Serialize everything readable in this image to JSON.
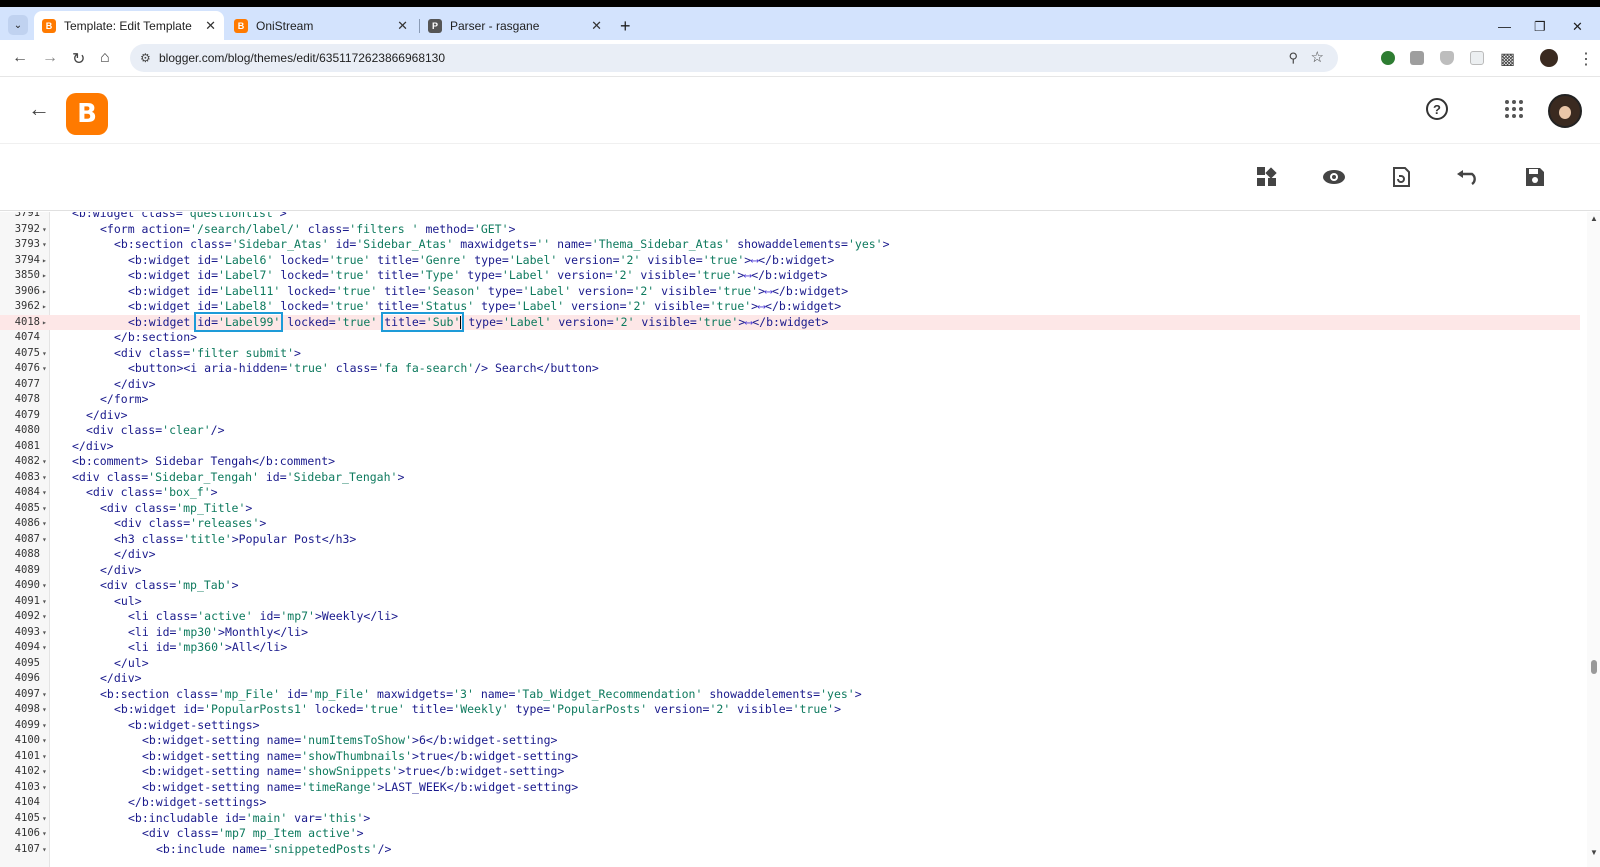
{
  "browser": {
    "tabs": [
      {
        "title": "Template: Edit Template",
        "favicon": "blogger-icon",
        "color": "#ff7a00",
        "active": true
      },
      {
        "title": "OniStream",
        "favicon": "blogger-icon",
        "color": "#ff7a00",
        "active": false
      },
      {
        "title": "Parser - rasgane",
        "favicon": "parser-icon",
        "color": "#555555",
        "active": false
      }
    ],
    "url": "blogger.com/blog/themes/edit/6351172623866968130",
    "new_tab_glyph": "+",
    "menu_glyph": "⌄",
    "close_glyph": "✕"
  },
  "app": {
    "logo_letter": "B",
    "help_glyph": "?",
    "toolbar": [
      "layout-icon",
      "preview-icon",
      "restore-icon",
      "undo-icon",
      "save-icon"
    ]
  },
  "editor": {
    "lines": [
      {
        "n": "3791",
        "f": "",
        "code": "<b:widget class='questionlist'>"
      },
      {
        "n": "3792",
        "f": "▾",
        "code": "<form action='/search/label/' class='filters ' method='GET'>"
      },
      {
        "n": "3793",
        "f": "▾",
        "code": "<b:section class='Sidebar_Atas' id='Sidebar_Atas' maxwidgets='' name='Thema_Sidebar_Atas' showaddelements='yes'>"
      },
      {
        "n": "3794",
        "f": "▸",
        "code": "<b:widget id='Label6' locked='true' title='Genre' type='Label' version='2' visible='true'>⟷</b:widget>"
      },
      {
        "n": "3850",
        "f": "▸",
        "code": "<b:widget id='Label7' locked='true' title='Type' type='Label' version='2' visible='true'>⟷</b:widget>"
      },
      {
        "n": "3906",
        "f": "▸",
        "code": "<b:widget id='Label11' locked='true' title='Season' type='Label' version='2' visible='true'>⟷</b:widget>"
      },
      {
        "n": "3962",
        "f": "▸",
        "code": "<b:widget id='Label8' locked='true' title='Status' type='Label' version='2' visible='true'>⟷</b:widget>"
      },
      {
        "n": "4018",
        "f": "▸",
        "code": "<b:widget id='Label99' locked='true' title='Sub' type='Label' version='2' visible='true'>⟷</b:widget>"
      },
      {
        "n": "4074",
        "f": "",
        "code": "</b:section>"
      },
      {
        "n": "4075",
        "f": "▾",
        "code": "<div class='filter submit'>"
      },
      {
        "n": "4076",
        "f": "▾",
        "code": "<button><i aria-hidden='true' class='fa fa-search'/> Search</button>"
      },
      {
        "n": "4077",
        "f": "",
        "code": "</div>"
      },
      {
        "n": "4078",
        "f": "",
        "code": "</form>"
      },
      {
        "n": "4079",
        "f": "",
        "code": "</div>"
      },
      {
        "n": "4080",
        "f": "",
        "code": "<div class='clear'/>"
      },
      {
        "n": "4081",
        "f": "",
        "code": "</div>"
      },
      {
        "n": "4082",
        "f": "▾",
        "code": "<b:comment> Sidebar Tengah</b:comment>"
      },
      {
        "n": "4083",
        "f": "▾",
        "code": "<div class='Sidebar_Tengah' id='Sidebar_Tengah'>"
      },
      {
        "n": "4084",
        "f": "▾",
        "code": "<div class='box_f'>"
      },
      {
        "n": "4085",
        "f": "▾",
        "code": "<div class='mp_Title'>"
      },
      {
        "n": "4086",
        "f": "▾",
        "code": "<div class='releases'>"
      },
      {
        "n": "4087",
        "f": "▾",
        "code": "<h3 class='title'>Popular Post</h3>"
      },
      {
        "n": "4088",
        "f": "",
        "code": "</div>"
      },
      {
        "n": "4089",
        "f": "",
        "code": "</div>"
      },
      {
        "n": "4090",
        "f": "▾",
        "code": "<div class='mp_Tab'>"
      },
      {
        "n": "4091",
        "f": "▾",
        "code": "<ul>"
      },
      {
        "n": "4092",
        "f": "▾",
        "code": "<li class='active' id='mp7'>Weekly</li>"
      },
      {
        "n": "4093",
        "f": "▾",
        "code": "<li id='mp30'>Monthly</li>"
      },
      {
        "n": "4094",
        "f": "▾",
        "code": "<li id='mp360'>All</li>"
      },
      {
        "n": "4095",
        "f": "",
        "code": "</ul>"
      },
      {
        "n": "4096",
        "f": "",
        "code": "</div>"
      },
      {
        "n": "4097",
        "f": "▾",
        "code": "<b:section class='mp_File' id='mp_File' maxwidgets='3' name='Tab_Widget_Recommendation' showaddelements='yes'>"
      },
      {
        "n": "4098",
        "f": "▾",
        "code": "<b:widget id='PopularPosts1' locked='true' title='Weekly' type='PopularPosts' version='2' visible='true'>"
      },
      {
        "n": "4099",
        "f": "▾",
        "code": "<b:widget-settings>"
      },
      {
        "n": "4100",
        "f": "▾",
        "code": "<b:widget-setting name='numItemsToShow'>6</b:widget-setting>"
      },
      {
        "n": "4101",
        "f": "▾",
        "code": "<b:widget-setting name='showThumbnails'>true</b:widget-setting>"
      },
      {
        "n": "4102",
        "f": "▾",
        "code": "<b:widget-setting name='showSnippets'>true</b:widget-setting>"
      },
      {
        "n": "4103",
        "f": "▾",
        "code": "<b:widget-setting name='timeRange'>LAST_WEEK</b:widget-setting>"
      },
      {
        "n": "4104",
        "f": "",
        "code": "</b:widget-settings>"
      },
      {
        "n": "4105",
        "f": "▾",
        "code": "<b:includable id='main' var='this'>"
      },
      {
        "n": "4106",
        "f": "▾",
        "code": "<div class='mp7 mp_Item active'>"
      },
      {
        "n": "4107",
        "f": "▾",
        "code": "<b:include name='snippetedPosts'/>"
      }
    ]
  }
}
